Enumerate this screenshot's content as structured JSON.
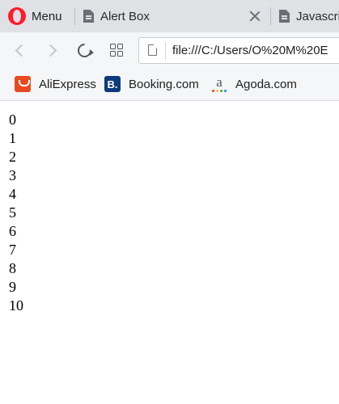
{
  "browser": {
    "menu_label": "Menu",
    "tabs": [
      {
        "title": "Alert Box"
      },
      {
        "title": "Javascript"
      }
    ]
  },
  "address_bar": {
    "url": "file:///C:/Users/O%20M%20E"
  },
  "bookmarks": [
    {
      "label": "AliExpress",
      "icon": "aliexpress-icon"
    },
    {
      "label": "Booking.com",
      "icon": "booking-icon",
      "icon_letter": "B."
    },
    {
      "label": "Agoda.com",
      "icon": "agoda-icon",
      "icon_letter": "a"
    }
  ],
  "page": {
    "lines": [
      "0",
      "1",
      "2",
      "3",
      "4",
      "5",
      "6",
      "7",
      "8",
      "9",
      "10"
    ]
  },
  "colors": {
    "opera_red": "#ff1b2d",
    "aliexpress": "#e84a1f",
    "booking": "#0b3b7b",
    "agoda_dots": [
      "#e53935",
      "#fbc02d",
      "#43a047",
      "#1e88e5",
      "#8e24aa"
    ]
  }
}
